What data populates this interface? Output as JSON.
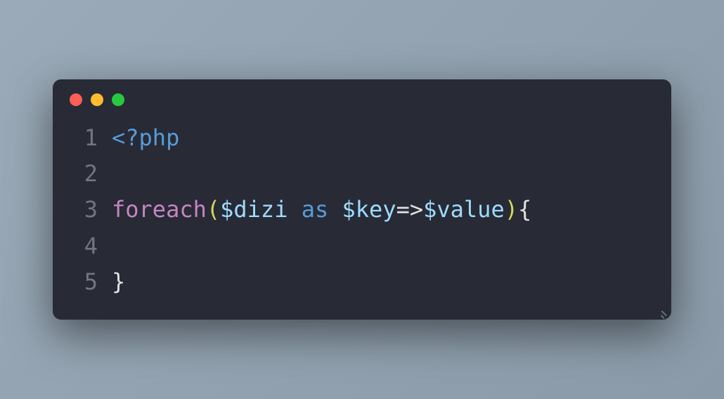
{
  "code": {
    "lines": [
      {
        "number": "1",
        "tokens": [
          {
            "class": "php-tag",
            "text": "<?php"
          }
        ]
      },
      {
        "number": "2",
        "tokens": []
      },
      {
        "number": "3",
        "tokens": [
          {
            "class": "keyword-foreach",
            "text": "foreach"
          },
          {
            "class": "paren",
            "text": "("
          },
          {
            "class": "variable",
            "text": "$dizi"
          },
          {
            "class": "plain",
            "text": " "
          },
          {
            "class": "keyword-as",
            "text": "as"
          },
          {
            "class": "plain",
            "text": " "
          },
          {
            "class": "variable",
            "text": "$key"
          },
          {
            "class": "operator",
            "text": "=>"
          },
          {
            "class": "variable",
            "text": "$value"
          },
          {
            "class": "paren",
            "text": ")"
          },
          {
            "class": "brace",
            "text": "{"
          }
        ]
      },
      {
        "number": "4",
        "tokens": []
      },
      {
        "number": "5",
        "tokens": [
          {
            "class": "brace",
            "text": "}"
          }
        ]
      }
    ]
  }
}
